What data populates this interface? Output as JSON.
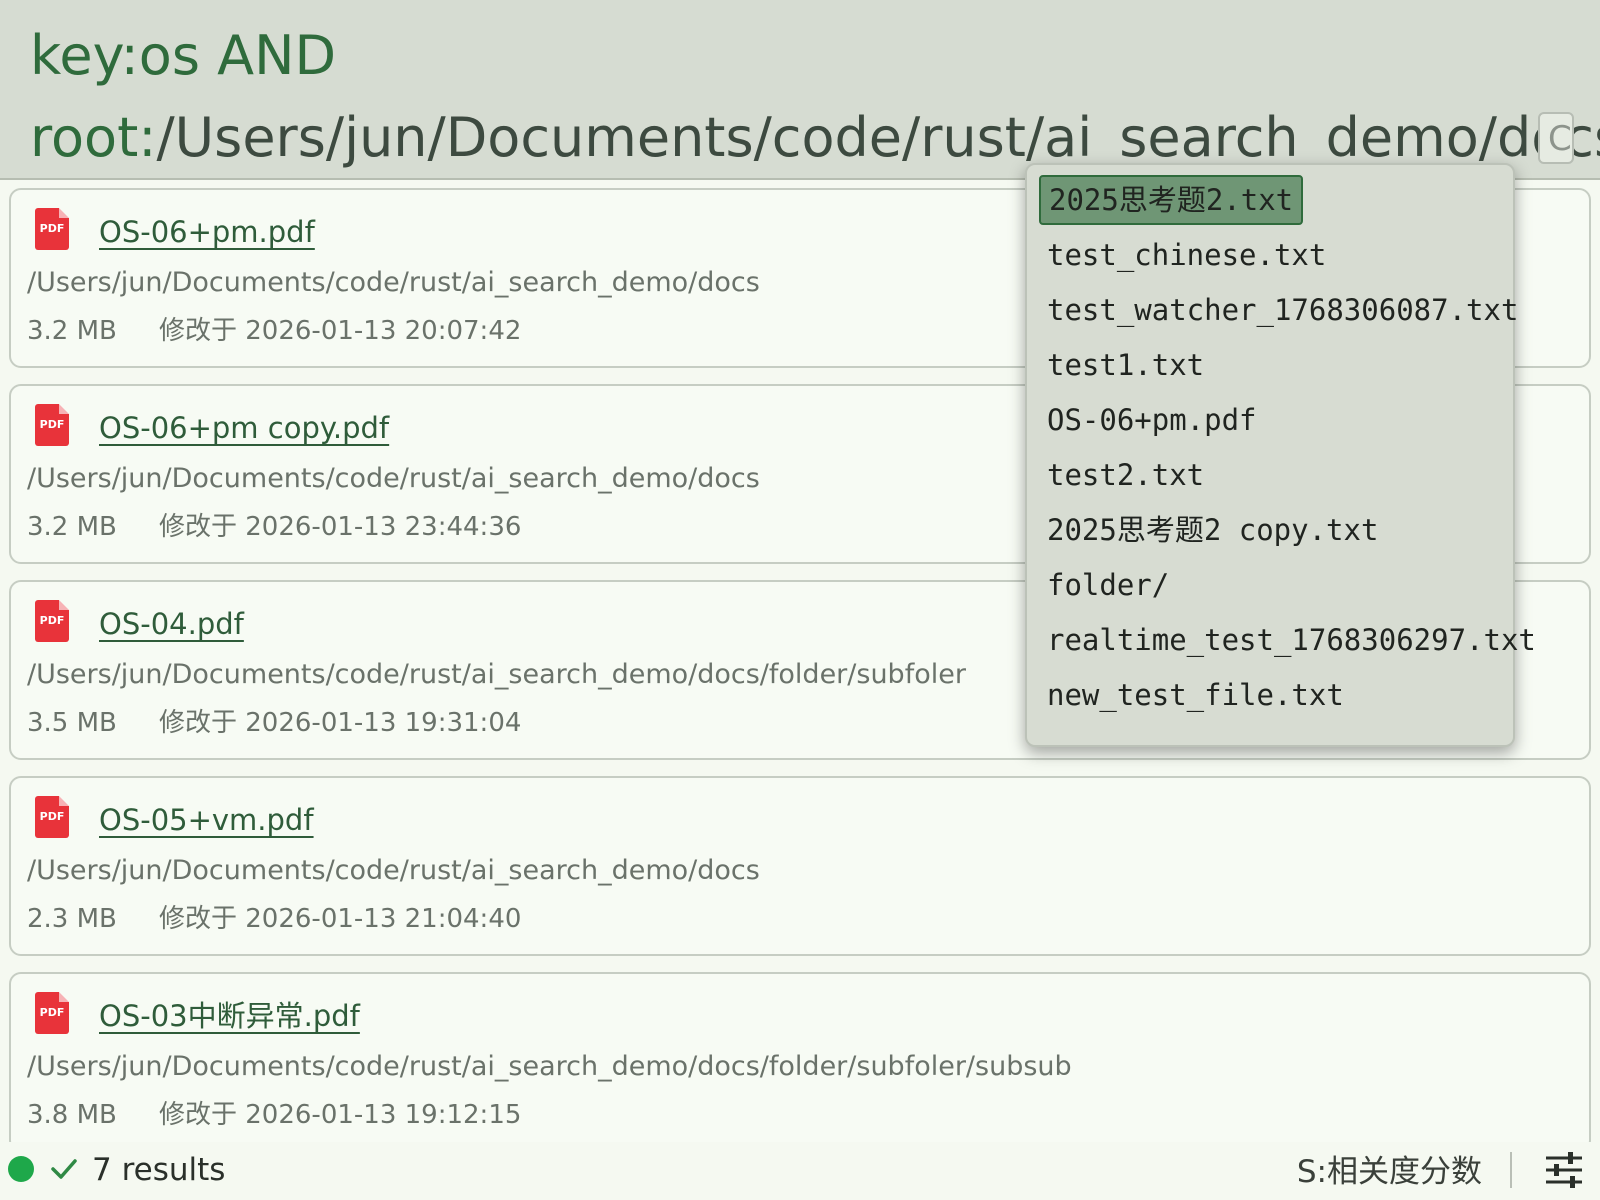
{
  "search": {
    "query_line1_key": "key:os AND",
    "query_line2_key": "root:",
    "query_line2_value": "/Users/jun/Documents/code/rust/ai_search_demo/docs/",
    "hint_text": "C"
  },
  "autocomplete": {
    "items": [
      "2025思考题2.txt",
      "test_chinese.txt",
      "test_watcher_1768306087.txt",
      "test1.txt",
      "OS-06+pm.pdf",
      "test2.txt",
      "2025思考题2 copy.txt",
      "folder/",
      "realtime_test_1768306297.txt",
      "new_test_file.txt"
    ],
    "selected_index": 0
  },
  "results": [
    {
      "icon": "pdf-icon",
      "icon_label": "PDF",
      "name": "OS-06+pm.pdf",
      "path": "/Users/jun/Documents/code/rust/ai_search_demo/docs",
      "size": "3.2 MB",
      "modified": "修改于 2026-01-13 20:07:42"
    },
    {
      "icon": "pdf-icon",
      "icon_label": "PDF",
      "name": "OS-06+pm copy.pdf",
      "path": "/Users/jun/Documents/code/rust/ai_search_demo/docs",
      "size": "3.2 MB",
      "modified": "修改于 2026-01-13 23:44:36"
    },
    {
      "icon": "pdf-icon",
      "icon_label": "PDF",
      "name": "OS-04.pdf",
      "path": "/Users/jun/Documents/code/rust/ai_search_demo/docs/folder/subfoler",
      "size": "3.5 MB",
      "modified": "修改于 2026-01-13 19:31:04"
    },
    {
      "icon": "pdf-icon",
      "icon_label": "PDF",
      "name": "OS-05+vm.pdf",
      "path": "/Users/jun/Documents/code/rust/ai_search_demo/docs",
      "size": "2.3 MB",
      "modified": "修改于 2026-01-13 21:04:40"
    },
    {
      "icon": "pdf-icon",
      "icon_label": "PDF",
      "name": "OS-03中断异常.pdf",
      "path": "/Users/jun/Documents/code/rust/ai_search_demo/docs/folder/subfoler/subsub",
      "size": "3.8 MB",
      "modified": "修改于 2026-01-13 19:12:15"
    }
  ],
  "status": {
    "indicator_color": "#1ea84a",
    "check_icon": "check-icon",
    "results_count": "7 results",
    "sort_label": "S:相关度分数",
    "settings_icon": "sliders-icon"
  },
  "colors": {
    "accent_green": "#2f6b3c",
    "pdf_red": "#e8333a",
    "header_bg": "#d6dcd2",
    "page_bg": "#f5f9f1"
  }
}
